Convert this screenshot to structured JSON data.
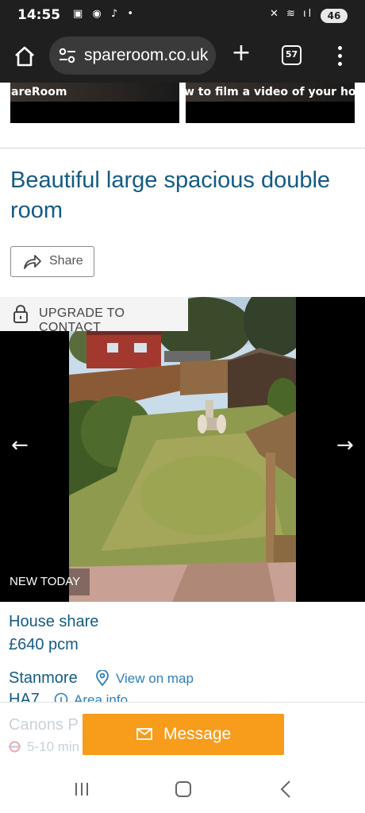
{
  "status_bar": {
    "time": "14:55",
    "left_icons": "▣ ◉ ♪ •",
    "right_icons": "✕ ≋ ıl",
    "battery": "46"
  },
  "browser": {
    "url": "spareroom.co.uk",
    "tab_count": "57",
    "icons": [
      "home-icon",
      "site-settings-icon",
      "new-tab-icon",
      "tabs-icon",
      "menu-icon"
    ]
  },
  "videos": [
    {
      "caption": "areRoom"
    },
    {
      "caption": "w to film a video of your hou"
    }
  ],
  "listing": {
    "title": "Beautiful large spacious double room",
    "share_label": "Share",
    "upgrade_label": "UPGRADE TO CONTACT",
    "badge": "NEW TODAY",
    "prev_arrow": "←",
    "next_arrow": "→",
    "type": "House share",
    "price": "£640 pcm",
    "area": "Stanmore",
    "map_link": "View on map",
    "postcode": "HA7",
    "area_link": "Area info",
    "station": "Canons P",
    "walk_time": "5-10 min"
  },
  "actions": {
    "message_label": "Message"
  },
  "colors": {
    "brand_blue": "#135b84",
    "link_blue": "#2f7fb8",
    "message_orange": "#f79c1b",
    "chrome_dark": "#1f1f1f"
  }
}
